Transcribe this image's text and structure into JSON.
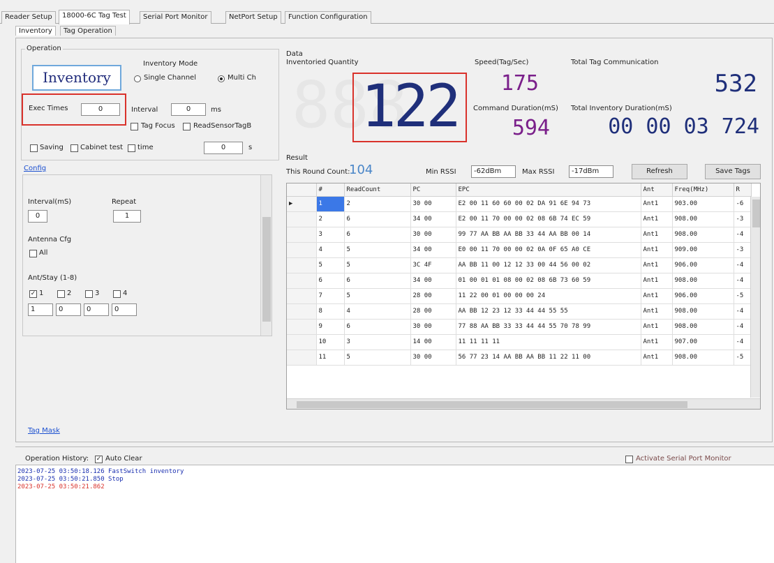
{
  "tabs": [
    "Reader Setup",
    "18000-6C Tag Test",
    "Serial Port Monitor",
    "NetPort Setup",
    "Function Configuration"
  ],
  "subtabs": [
    "Inventory",
    "Tag Operation"
  ],
  "operation": {
    "legend": "Operation",
    "inventory_button": "Inventory",
    "mode_label": "Inventory Mode",
    "mode_single": "Single Channel",
    "mode_multi": "Multi Ch",
    "exec_times_label": "Exec Times",
    "exec_times_value": "0",
    "interval_label": "Interval",
    "interval_value": "0",
    "interval_unit": "ms",
    "tag_focus": "Tag Focus",
    "read_sensor": "ReadSensorTagB",
    "saving": "Saving",
    "cabinet_test": "Cabinet test",
    "time": "time",
    "time_value": "0",
    "time_unit": "s"
  },
  "config": {
    "link": "Config",
    "interval_label": "Interval(mS)",
    "repeat_label": "Repeat",
    "interval_value": "0",
    "repeat_value": "1",
    "antenna_cfg_label": "Antenna Cfg",
    "all_label": "All",
    "ant_stay_label": "Ant/Stay (1-8)",
    "ant_checks": [
      "1",
      "2",
      "3",
      "4"
    ],
    "ant_values": [
      "1",
      "0",
      "0",
      "0"
    ]
  },
  "tag_mask_link": "Tag Mask",
  "data": {
    "legend": "Data",
    "inventoried_label": "Inventoried Quantity",
    "inventoried_value": "122",
    "inventoried_ghost": "888",
    "speed_label": "Speed(Tag/Sec)",
    "speed_value": "175",
    "total_comm_label": "Total Tag Communication",
    "total_comm_value": "532",
    "cmd_duration_label": "Command Duration(mS)",
    "cmd_duration_value": "594",
    "total_duration_label": "Total Inventory Duration(mS)",
    "total_duration_value": "00 00 03 724"
  },
  "results": {
    "legend": "Result",
    "round_count_label": "This Round Count:",
    "round_count_value": "104",
    "min_rssi_label": "Min RSSI",
    "min_rssi_value": "-62dBm",
    "max_rssi_label": "Max RSSI",
    "max_rssi_value": "-17dBm",
    "refresh_button": "Refresh",
    "save_button": "Save Tags",
    "columns": [
      "#",
      "ReadCount",
      "PC",
      "EPC",
      "Ant",
      "Freq(MHz)",
      "R"
    ],
    "rows": [
      [
        "1",
        "2",
        "30 00",
        "E2 00 11 60 60 00 02 DA 91 6E 94 73",
        "Ant1",
        "903.00",
        "-6"
      ],
      [
        "2",
        "6",
        "34 00",
        "E2 00 11 70 00 00 02 08 6B 74 EC 59",
        "Ant1",
        "908.00",
        "-3"
      ],
      [
        "3",
        "6",
        "30 00",
        "99 77 AA BB AA BB 33 44 AA BB 00 14",
        "Ant1",
        "908.00",
        "-4"
      ],
      [
        "4",
        "5",
        "34 00",
        "E0 00 11 70 00 00 02 0A 0F 65 A0 CE",
        "Ant1",
        "909.00",
        "-3"
      ],
      [
        "5",
        "5",
        "3C 4F",
        "AA BB 11 00 12 12 33 00 44 56 00 02",
        "Ant1",
        "906.00",
        "-4"
      ],
      [
        "6",
        "6",
        "34 00",
        "01 00 01 01 08 00 02 08 6B 73 60 59",
        "Ant1",
        "908.00",
        "-4"
      ],
      [
        "7",
        "5",
        "28 00",
        "11 22 00 01 00 00 00 24",
        "Ant1",
        "906.00",
        "-5"
      ],
      [
        "8",
        "4",
        "28 00",
        "AA BB 12 23 12 33 44 44 55 55",
        "Ant1",
        "908.00",
        "-4"
      ],
      [
        "9",
        "6",
        "30 00",
        "77 88 AA BB 33 33 44 44 55 70 78 99",
        "Ant1",
        "908.00",
        "-4"
      ],
      [
        "10",
        "3",
        "14 00",
        "11 11 11 11",
        "Ant1",
        "907.00",
        "-4"
      ],
      [
        "11",
        "5",
        "30 00",
        "56 77 23 14 AA BB AA BB 11 22 11 00",
        "Ant1",
        "908.00",
        "-5"
      ]
    ]
  },
  "history": {
    "label": "Operation History:",
    "auto_clear": "Auto Clear",
    "activate_monitor": "Activate Serial Port Monitor",
    "lines": [
      {
        "text": "2023-07-25 03:50:18.126 FastSwitch inventory",
        "color": "#1a2fb0"
      },
      {
        "text": "2023-07-25 03:50:21.850 Stop",
        "color": "#1a2fb0"
      },
      {
        "text": "2023-07-25 03:50:21.862",
        "color": "#d9322b"
      }
    ]
  },
  "colors": {
    "digits_navy": "#1f2f7a",
    "digits_purple": "#7a1f8a",
    "highlight_red": "#d9322b",
    "selection_blue": "#3b78e7"
  }
}
